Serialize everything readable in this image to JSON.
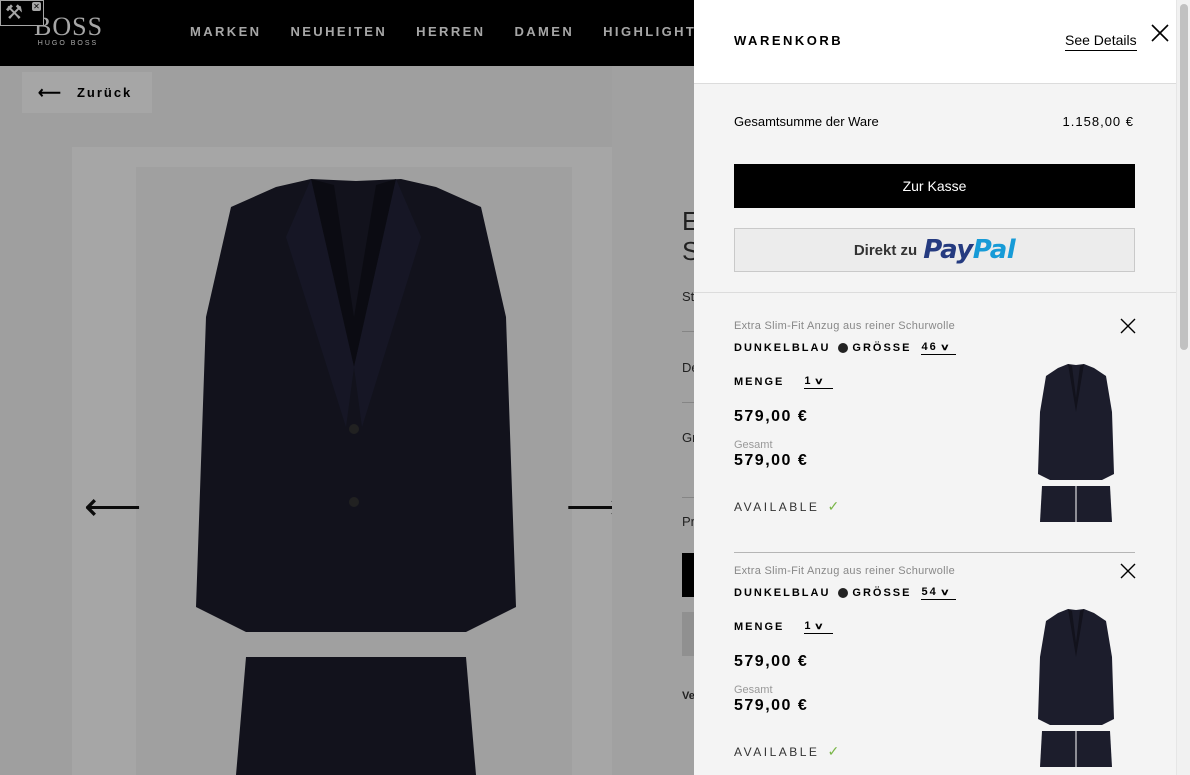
{
  "nav": {
    "logo": "BOSS",
    "logo_sub": "HUGO BOSS",
    "items": [
      "MARKEN",
      "NEUHEITEN",
      "HERREN",
      "DAMEN",
      "HIGHLIGHTS"
    ]
  },
  "page": {
    "back_label": "Zurück"
  },
  "cart": {
    "title": "WARENKORB",
    "see_details": "See Details",
    "subtotal_label": "Gesamtsumme der Ware",
    "subtotal_value": "1.158,00 €",
    "checkout_label": "Zur Kasse",
    "paypal_prefix": "Direkt zu",
    "paypal_brand_1": "Pay",
    "paypal_brand_2": "Pal",
    "items": [
      {
        "name": "Extra Slim-Fit Anzug aus reiner Schurwolle",
        "color": "DUNKELBLAU",
        "size_label": "GRÖSSE",
        "size": "46",
        "qty_label": "MENGE",
        "qty": "1",
        "price": "579,00 €",
        "total_label": "Gesamt",
        "total": "579,00 €",
        "availability": "AVAILABLE"
      },
      {
        "name": "Extra Slim-Fit Anzug aus reiner Schurwolle",
        "color": "DUNKELBLAU",
        "size_label": "GRÖSSE",
        "size": "54",
        "qty_label": "MENGE",
        "qty": "1",
        "price": "579,00 €",
        "total_label": "Gesamt",
        "total": "579,00 €",
        "availability": "AVAILABLE"
      }
    ]
  },
  "colors": {
    "accent_check": "#7ab648",
    "paypal_dark": "#253b80",
    "paypal_light": "#179bd7"
  }
}
